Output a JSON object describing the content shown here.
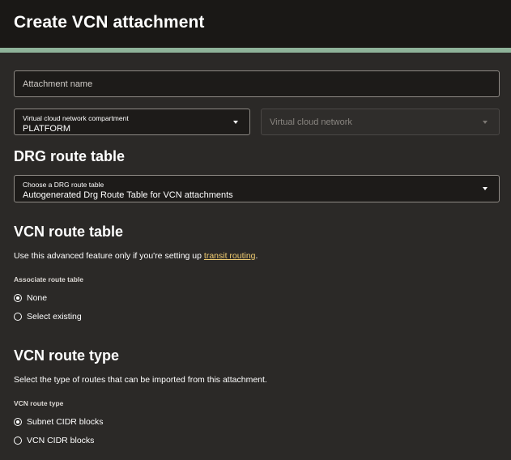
{
  "header": {
    "title": "Create VCN attachment"
  },
  "attachment_name": {
    "placeholder": "Attachment name"
  },
  "compartment": {
    "label": "Virtual cloud network compartment",
    "value": "PLATFORM"
  },
  "vcn": {
    "placeholder": "Virtual cloud network"
  },
  "drg_route_table": {
    "title": "DRG route table",
    "select_label": "Choose a DRG route table",
    "select_value": "Autogenerated Drg Route Table for VCN attachments"
  },
  "vcn_route_table": {
    "title": "VCN route table",
    "desc_before": "Use this advanced feature only if you're setting up ",
    "desc_link": "transit routing",
    "desc_after": ".",
    "group_label": "Associate route table",
    "options": [
      {
        "label": "None",
        "checked": true
      },
      {
        "label": "Select existing",
        "checked": false
      }
    ]
  },
  "vcn_route_type": {
    "title": "VCN route type",
    "desc": "Select the type of routes that can be imported from this attachment.",
    "group_label": "VCN route type",
    "options": [
      {
        "label": "Subnet CIDR blocks",
        "checked": true
      },
      {
        "label": "VCN CIDR blocks",
        "checked": false
      }
    ]
  },
  "colors": {
    "accent_bar": "#8fb39a",
    "link": "#f0cc71",
    "background": "#2b2927",
    "header_bg": "#1a1816"
  },
  "icons": {
    "dropdown": "chevron-down-icon",
    "radio_checked": "radio-checked-icon",
    "radio_unchecked": "radio-unchecked-icon"
  }
}
